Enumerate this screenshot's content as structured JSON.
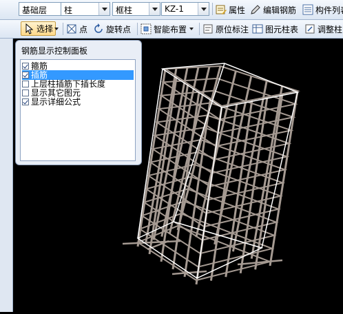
{
  "toolbar1": {
    "floor": "基础层",
    "category": "柱",
    "subtype": "框柱",
    "element": "KZ-1",
    "properties_label": "属性",
    "edit_rebar_label": "编辑钢筋",
    "component_list_label": "构件列表"
  },
  "toolbar2": {
    "select_label": "选择",
    "point_label": "点",
    "rotate_point_label": "旋转点",
    "smart_layout_label": "智能布置",
    "in_situ_label": "原位标注",
    "element_table_label": "图元柱表",
    "adjust_label": "调整柱"
  },
  "panel": {
    "title": "钢筋显示控制面板",
    "options": [
      {
        "label": "箍筋",
        "checked": true
      },
      {
        "label": "插筋",
        "checked": true
      },
      {
        "label": "上层柱插筋下插长度",
        "checked": false
      },
      {
        "label": "显示其它图元",
        "checked": false
      },
      {
        "label": "显示详细公式",
        "checked": true
      }
    ]
  },
  "colors": {
    "rebar": "#a59a92",
    "wireframe": "#ffffff",
    "selection": "#3399ff"
  }
}
